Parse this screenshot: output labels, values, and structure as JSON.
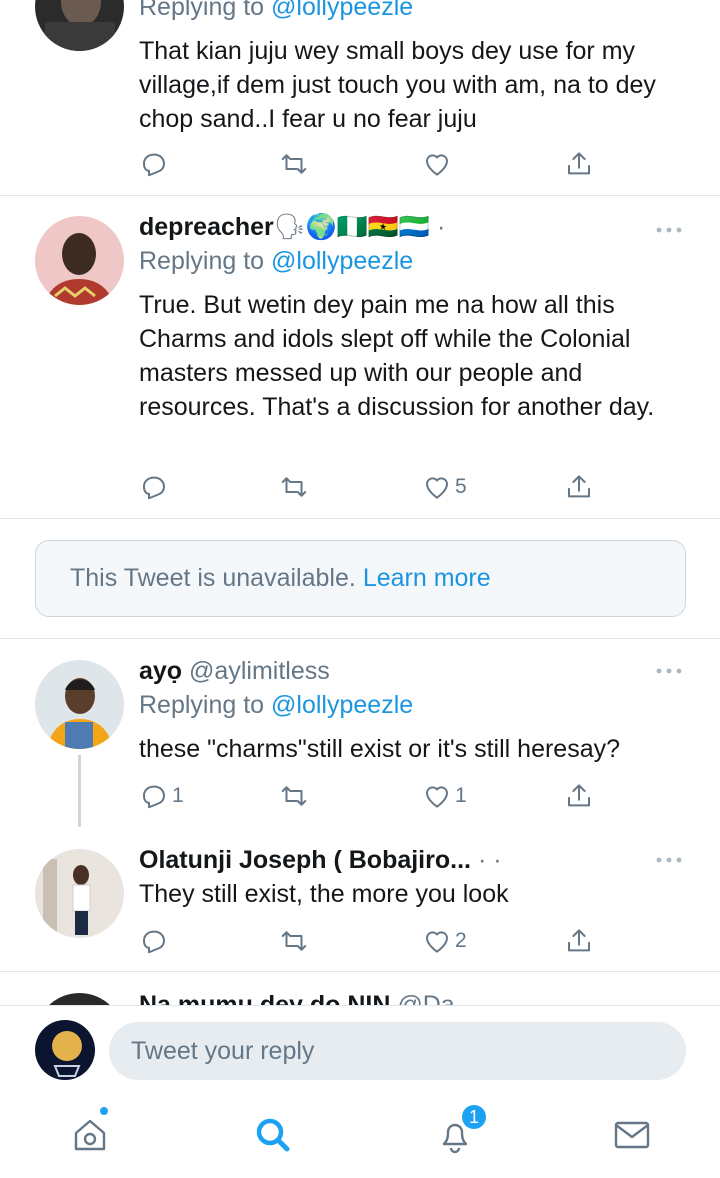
{
  "tweets": [
    {
      "reply_prefix": "Replying to",
      "reply_handle": "@lollypeezle",
      "text": "That kian juju wey small boys dey use for my village,if dem just touch you with am, na to dey chop sand..I fear u no fear juju",
      "counts": {
        "reply": "",
        "retweet": "",
        "like": ""
      }
    },
    {
      "name": "depreacher",
      "name_emoji": "🗣🌍🇳🇬🇬🇭🇸🇱 ·",
      "reply_prefix": "Replying to",
      "reply_handle": "@lollypeezle",
      "text": "True. But wetin dey pain me na how all this Charms and idols slept off while the Colonial masters messed up with our people and resources. That's a discussion for another day.",
      "counts": {
        "reply": "",
        "retweet": "",
        "like": "5"
      }
    },
    {
      "name": "ayọ",
      "handle": "@aylimitless",
      "reply_prefix": "Replying to",
      "reply_handle": "@lollypeezle",
      "text": "these \"charms\"still exist or it's still heresay?",
      "counts": {
        "reply": "1",
        "retweet": "",
        "like": "1"
      }
    },
    {
      "name": "Olatunji Joseph ( Bobajiro...",
      "handle": "· ·",
      "text": "They still exist, the more you look",
      "counts": {
        "reply": "",
        "retweet": "",
        "like": "2"
      }
    },
    {
      "name": "Na mumu dey do NIN",
      "handle": "@Da"
    }
  ],
  "unavailable": {
    "text": "This Tweet is unavailable.",
    "link": "Learn more"
  },
  "composer": {
    "placeholder": "Tweet your reply"
  },
  "tabbar": {
    "notifications_badge": "1",
    "home_icon": "home-icon",
    "search_icon": "search-icon",
    "notifications_icon": "bell-icon",
    "messages_icon": "mail-icon"
  },
  "colors": {
    "accent": "#1da1f2",
    "link": "#1b95e0",
    "muted": "#657786",
    "divider": "#e1e8ed"
  }
}
